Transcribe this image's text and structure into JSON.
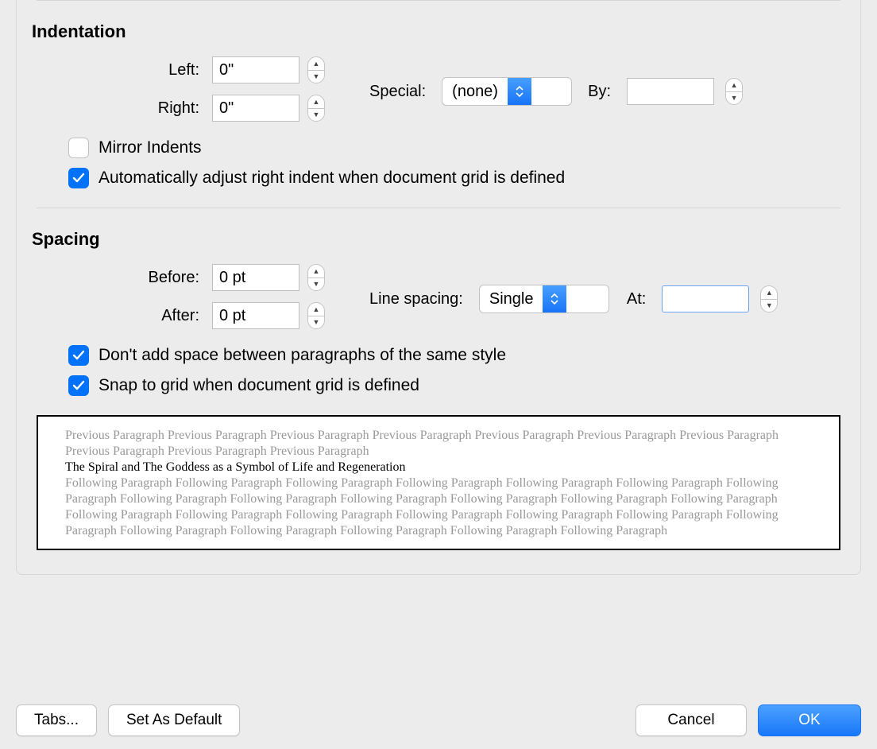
{
  "indentation": {
    "title": "Indentation",
    "left_label": "Left:",
    "left_value": "0\"",
    "right_label": "Right:",
    "right_value": "0\"",
    "special_label": "Special:",
    "special_value": "(none)",
    "by_label": "By:",
    "by_value": "",
    "mirror_label": "Mirror Indents",
    "auto_adjust_label": "Automatically adjust right indent when document grid is defined"
  },
  "spacing": {
    "title": "Spacing",
    "before_label": "Before:",
    "before_value": "0 pt",
    "after_label": "After:",
    "after_value": "0 pt",
    "line_spacing_label": "Line spacing:",
    "line_spacing_value": "Single",
    "at_label": "At:",
    "at_value": "",
    "dont_add_label": "Don't add space between paragraphs of the same style",
    "snap_label": "Snap to grid when document grid is defined"
  },
  "preview": {
    "previous": "Previous Paragraph Previous Paragraph Previous Paragraph Previous Paragraph Previous Paragraph Previous Paragraph Previous Paragraph Previous Paragraph Previous Paragraph Previous Paragraph",
    "sample": "The Spiral and The Goddess as a Symbol of Life and Regeneration",
    "following": "Following Paragraph Following Paragraph Following Paragraph Following Paragraph Following Paragraph Following Paragraph Following Paragraph Following Paragraph Following Paragraph Following Paragraph Following Paragraph Following Paragraph Following Paragraph Following Paragraph Following Paragraph Following Paragraph Following Paragraph Following Paragraph Following Paragraph Following Paragraph Following Paragraph Following Paragraph Following Paragraph Following Paragraph Following Paragraph"
  },
  "buttons": {
    "tabs": "Tabs...",
    "set_default": "Set As Default",
    "cancel": "Cancel",
    "ok": "OK"
  }
}
